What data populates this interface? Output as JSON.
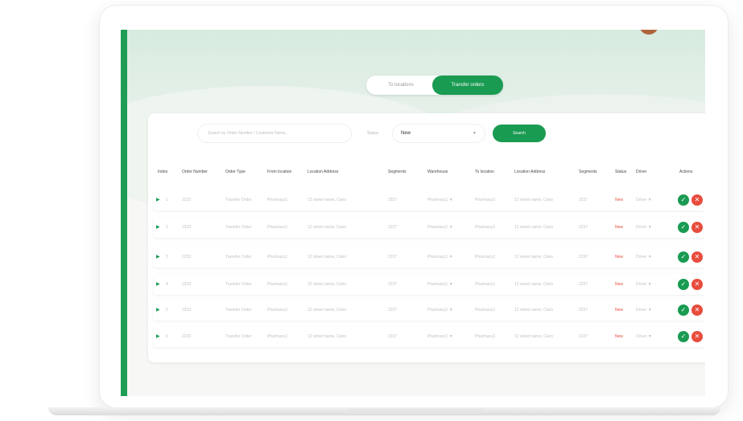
{
  "toggle": {
    "option_1": "To locations",
    "option_2": "Transfer orders"
  },
  "filters": {
    "search_placeholder": "Search by Order Number / Customer Name...",
    "status_label": "Status",
    "status_value": "New",
    "search_button": "Search"
  },
  "table": {
    "headers": [
      "Index",
      "Order Number",
      "Order Type",
      "From location",
      "Location Address",
      "Segments",
      "Warehouse",
      "To location",
      "Location Address",
      "Segments",
      "Status",
      "Driver",
      "Actions"
    ],
    "rows": [
      {
        "index": "1",
        "order_number": "2233",
        "order_type": "Transfer Order",
        "from": "Pharmacy1",
        "address": "12 street name, Cairo",
        "segments": "2237",
        "warehouse": "Pharmacy1",
        "to": "Pharmacy1",
        "to_address": "12 street name, Cairo",
        "to_segments": "2237",
        "status": "New",
        "driver": "Driver"
      },
      {
        "index": "2",
        "order_number": "2233",
        "order_type": "Transfer Order",
        "from": "Pharmacy1",
        "address": "12 street name, Cairo",
        "segments": "2237",
        "warehouse": "Pharmacy1",
        "to": "Pharmacy1",
        "to_address": "12 street name, Cairo",
        "to_segments": "2237",
        "status": "New",
        "driver": "Driver"
      },
      {
        "index": "3",
        "order_number": "2233",
        "order_type": "Transfer Order",
        "from": "Pharmacy1",
        "address": "12 street name, Cairo",
        "segments": "2237",
        "warehouse": "Pharmacy1",
        "to": "Pharmacy1",
        "to_address": "12 street name, Cairo",
        "to_segments": "2237",
        "status": "New",
        "driver": "Driver"
      },
      {
        "index": "4",
        "order_number": "2233",
        "order_type": "Transfer Order",
        "from": "Pharmacy1",
        "address": "12 street name, Cairo",
        "segments": "2237",
        "warehouse": "Pharmacy1",
        "to": "Pharmacy1",
        "to_address": "12 street name, Cairo",
        "to_segments": "2237",
        "status": "New",
        "driver": "Driver"
      },
      {
        "index": "5",
        "order_number": "2233",
        "order_type": "Transfer Order",
        "from": "Pharmacy1",
        "address": "12 street name, Cairo",
        "segments": "2237",
        "warehouse": "Pharmacy1",
        "to": "Pharmacy1",
        "to_address": "12 street name, Cairo",
        "to_segments": "2237",
        "status": "New",
        "driver": "Driver"
      },
      {
        "index": "6",
        "order_number": "2233",
        "order_type": "Transfer Order",
        "from": "Pharmacy1",
        "address": "12 street name, Cairo",
        "segments": "2237",
        "warehouse": "Pharmacy1",
        "to": "Pharmacy1",
        "to_address": "12 street name, Cairo",
        "to_segments": "2237",
        "status": "New",
        "driver": "Driver"
      }
    ]
  },
  "colors": {
    "brand_green": "#1a9b52",
    "status_red": "#e74c3c",
    "reject_red": "#e74c3c"
  },
  "icons": {
    "expand": "play-arrow-icon",
    "approve": "check-circle-icon",
    "reject": "close-circle-icon",
    "dropdown": "chevron-down-icon"
  }
}
